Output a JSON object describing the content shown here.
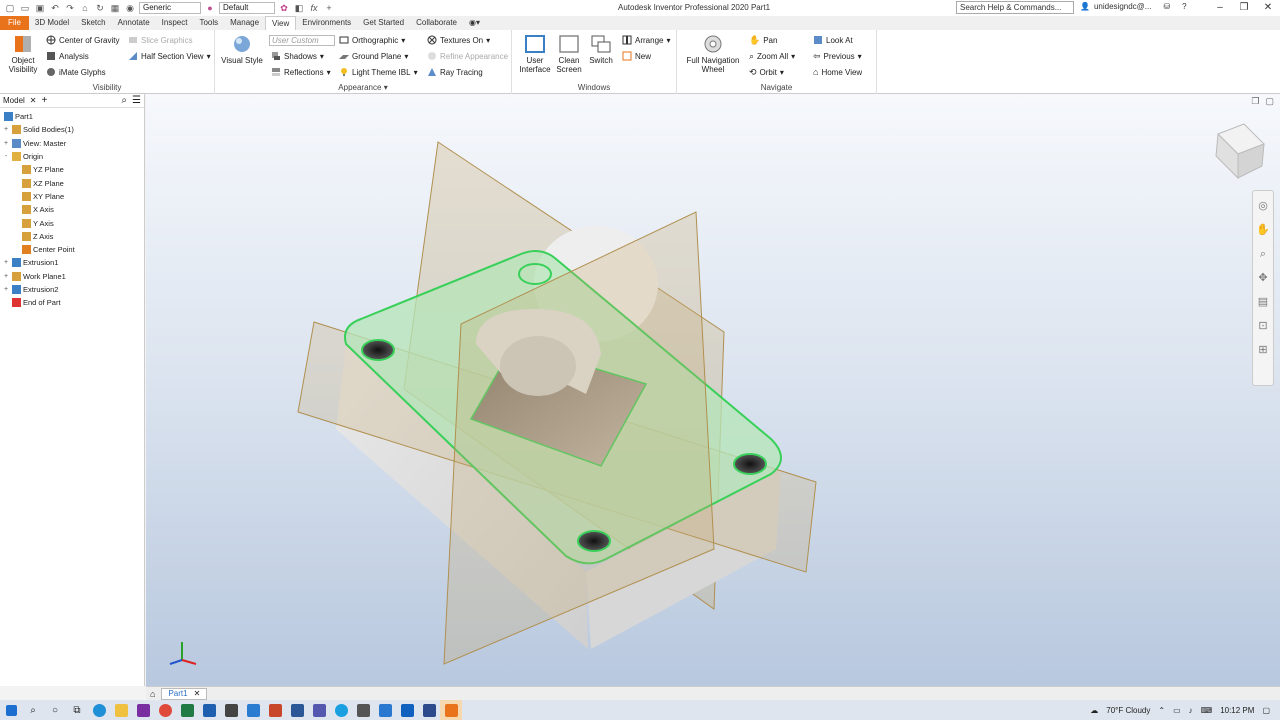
{
  "titlebar": {
    "app_title": "Autodesk Inventor Professional 2020   Part1",
    "appearance_select": "Generic",
    "style_select": "Default",
    "search_placeholder": "Search Help & Commands...",
    "user": "unidesigndc@..."
  },
  "tabs": [
    "File",
    "3D Model",
    "Sketch",
    "Annotate",
    "Inspect",
    "Tools",
    "Manage",
    "View",
    "Environments",
    "Get Started",
    "Collaborate"
  ],
  "active_tab": "View",
  "ribbon": {
    "visibility": {
      "label": "Visibility",
      "object_visibility": "Object Visibility",
      "center_of_gravity": "Center of Gravity",
      "analysis": "Analysis",
      "imate_glyphs": "iMate Glyphs",
      "slice_graphics": "Slice Graphics",
      "half_section_view": "Half Section View"
    },
    "appearance": {
      "label": "Appearance",
      "visual_style": "Visual Style",
      "user_custom": "User Custom",
      "shadows": "Shadows",
      "reflections": "Reflections",
      "orthographic": "Orthographic",
      "ground_plane": "Ground Plane",
      "light_theme": "Light Theme IBL",
      "textures_on": "Textures On",
      "refine_appearance": "Refine Appearance",
      "ray_tracing": "Ray Tracing"
    },
    "windows": {
      "label": "Windows",
      "user_interface": "User Interface",
      "clean_screen": "Clean Screen",
      "switch": "Switch",
      "arrange": "Arrange",
      "new": "New"
    },
    "navigate": {
      "label": "Navigate",
      "full_navigation_wheel": "Full Navigation Wheel",
      "pan": "Pan",
      "zoom_all": "Zoom All",
      "orbit": "Orbit",
      "look_at": "Look At",
      "previous": "Previous",
      "home_view": "Home View"
    }
  },
  "browser": {
    "tab": "Model",
    "nodes": [
      {
        "label": "Part1",
        "level": 0,
        "exp": "",
        "icon": "#3b7fc4"
      },
      {
        "label": "Solid Bodies(1)",
        "level": 1,
        "exp": "+",
        "icon": "#d6a03c"
      },
      {
        "label": "View: Master",
        "level": 1,
        "exp": "+",
        "icon": "#5b8cc8"
      },
      {
        "label": "Origin",
        "level": 1,
        "exp": "-",
        "icon": "#e0b040"
      },
      {
        "label": "YZ Plane",
        "level": 2,
        "exp": "",
        "icon": "#d6a03c"
      },
      {
        "label": "XZ Plane",
        "level": 2,
        "exp": "",
        "icon": "#d6a03c"
      },
      {
        "label": "XY Plane",
        "level": 2,
        "exp": "",
        "icon": "#d6a03c"
      },
      {
        "label": "X Axis",
        "level": 2,
        "exp": "",
        "icon": "#d6a03c"
      },
      {
        "label": "Y Axis",
        "level": 2,
        "exp": "",
        "icon": "#d6a03c"
      },
      {
        "label": "Z Axis",
        "level": 2,
        "exp": "",
        "icon": "#d6a03c"
      },
      {
        "label": "Center Point",
        "level": 2,
        "exp": "",
        "icon": "#e08020"
      },
      {
        "label": "Extrusion1",
        "level": 1,
        "exp": "+",
        "icon": "#3b7fc4"
      },
      {
        "label": "Work Plane1",
        "level": 1,
        "exp": "+",
        "icon": "#d6a03c"
      },
      {
        "label": "Extrusion2",
        "level": 1,
        "exp": "+",
        "icon": "#3b7fc4"
      },
      {
        "label": "End of Part",
        "level": 1,
        "exp": "",
        "icon": "#d33"
      }
    ]
  },
  "document_tab": "Part1",
  "taskbar": {
    "weather": "70°F  Cloudy",
    "time": "10:12 PM"
  }
}
